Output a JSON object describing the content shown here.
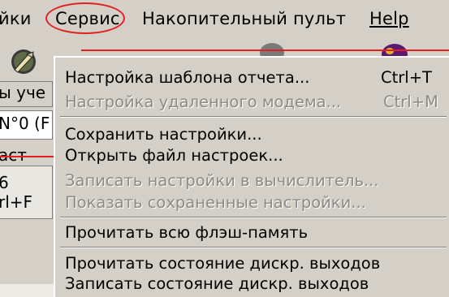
{
  "menubar": {
    "partial_label": "йки",
    "service": "Сервис",
    "accumulator": "Накопительный пульт",
    "help": "Help"
  },
  "left_panel": {
    "accounts_text": "ы уче",
    "number_text": "N°0 (F",
    "partial_text": "аст",
    "shortcut_6": "6",
    "shortcut_ctrlf": "rl+F"
  },
  "dropdown": {
    "items": [
      {
        "label": "Настройка шаблона отчета...",
        "shortcut": "Ctrl+T",
        "enabled": true
      },
      {
        "label": "Настройка удаленного модема...",
        "shortcut": "Ctrl+M",
        "enabled": false
      },
      {
        "label": "Сохранить настройки...",
        "shortcut": "",
        "enabled": true
      },
      {
        "label": "Открыть файл настроек...",
        "shortcut": "",
        "enabled": true
      },
      {
        "label": "Записать настройки в вычислитель...",
        "shortcut": "",
        "enabled": false
      },
      {
        "label": "Показать сохраненные настройки...",
        "shortcut": "",
        "enabled": false
      },
      {
        "label": "Прочитать всю флэш-память",
        "shortcut": "",
        "enabled": true
      },
      {
        "label": "Прочитать состояние дискр. выходов",
        "shortcut": "",
        "enabled": true
      },
      {
        "label": "Записать состояние дискр. выходов",
        "shortcut": "",
        "enabled": true
      }
    ]
  },
  "colors": {
    "highlight_ring": "#e02020",
    "menu_bg": "#d4d0c8",
    "disabled_text": "#8c8a84"
  }
}
